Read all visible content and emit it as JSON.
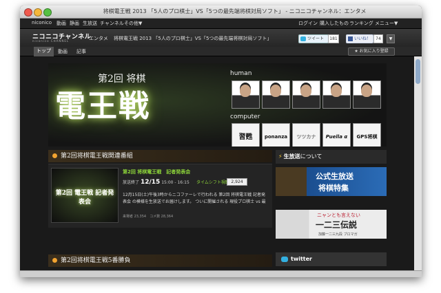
{
  "window": {
    "title": "将棋電王戦 2013 「5人のプロ棋士」VS「5つの最先端将棋対局ソフト」 - ニコニコチャンネル：エンタメ"
  },
  "topnav": {
    "left": [
      "niconico",
      "動画",
      "静画",
      "生放送",
      "チャンネル",
      "その他▼"
    ],
    "right": [
      "ログイン",
      "購入したもの",
      "ランキング",
      "メニュー▼"
    ]
  },
  "channel": {
    "logo": "ニコニコチャンネル",
    "logo_sub": "niconico CHANNEL",
    "category": "エンタメ",
    "title": "将棋電王戦 2013 「5人のプロ棋士」VS「5つの最先端将棋対局ソフト」",
    "tweet_label": "ツイート",
    "tweet_count": "181",
    "like_label": "いいね！",
    "like_count": "74",
    "dropdown": "▼"
  },
  "tabs": {
    "items": [
      "トップ",
      "動画",
      "記事"
    ],
    "favorite": "★ お気に入り登録"
  },
  "hero": {
    "subtitle": "第2回 将棋",
    "main": "電王戦",
    "human_label": "human",
    "computer_label": "computer",
    "programs": [
      "習甦",
      "ponanza",
      "ツツカナ",
      "Puella α",
      "GPS将棋"
    ]
  },
  "section1": {
    "title": "第2回将棋電王戦関連番組"
  },
  "program": {
    "thumb_text": "第2回 電王戦 記者発表会",
    "title": "第2回 将棋電王戦　記者発表会",
    "status": "放送終了",
    "date": "12/15",
    "time": "15:00 - 16:15",
    "timeshift": "タイムシフト視聴",
    "count": "2,924",
    "desc": "12月15日(土)午後3時からニコファーレで行われる 第2回 将棋電王戦 記者発表会 の模様を生放送でお届けします。 ついに開催される 現役プロ棋士 vs 最",
    "stats": "来場者 23,354　コメ数 28,364"
  },
  "section2": {
    "title": "第2回将棋電王戦5番勝負"
  },
  "sidebar": {
    "live_title": "生放送",
    "live_suffix": "について",
    "banner1_line1": "公式生放送",
    "banner1_line2": "将棋特集",
    "banner2_line1": "ニャンとも言えない",
    "banner2_line2": "一二三伝説",
    "banner2_caption": "加藤一二三九段 ブロマガ",
    "twitter": "twitter"
  },
  "colors": {
    "accent_green": "#8ed63a",
    "orange": "#f2a330",
    "fb_blue": "#3b5998",
    "tw_blue": "#33b0e0"
  }
}
